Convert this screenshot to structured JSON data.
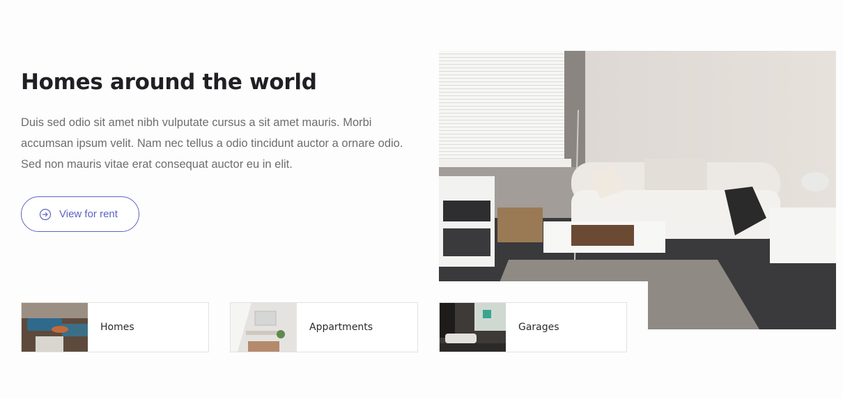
{
  "section": {
    "title": "Homes around the world",
    "description": "Duis sed odio sit amet nibh vulputate cursus a sit amet mauris. Morbi accumsan ipsum velit. Nam nec tellus a odio tincidunt auctor a ornare odio. Sed non mauris vitae erat consequat auctor eu in elit.",
    "button": {
      "label": "View for rent",
      "icon": "arrow-circle-right-icon"
    }
  },
  "hero_image": {
    "subject": "living-room-photo"
  },
  "categories": [
    {
      "label": "Homes",
      "thumbnail": "homes-thumbnail"
    },
    {
      "label": "Appartments",
      "thumbnail": "apartments-thumbnail"
    },
    {
      "label": "Garages",
      "thumbnail": "garages-thumbnail"
    }
  ],
  "colors": {
    "accent": "#5c62c4",
    "heading": "#1f1f24",
    "body_text": "#6d6d72"
  }
}
